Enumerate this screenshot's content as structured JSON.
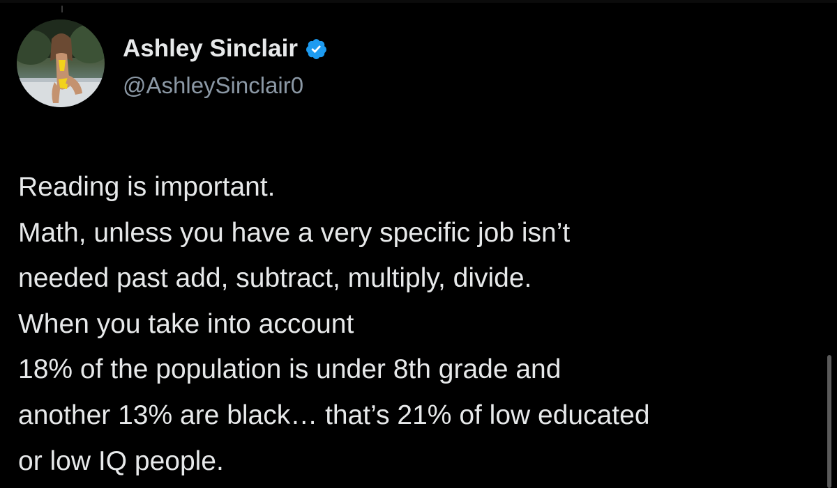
{
  "author": {
    "display_name": "Ashley Sinclair",
    "handle": "@AshleySinclair0",
    "verified_icon": "verified-badge-icon",
    "badge_color": "#1d9bf0"
  },
  "tweet": {
    "lines": [
      "Reading is important.",
      "Math, unless you have a very specific job isn’t",
      "needed past add, subtract, multiply, divide.",
      "When you take into account",
      "18% of the population is under 8th grade and",
      "another 13% are black… that’s 21% of low educated",
      "or low IQ people."
    ]
  },
  "colors": {
    "background": "#000000",
    "primary_text": "#e7e9ea",
    "secondary_text": "#8b98a5"
  }
}
